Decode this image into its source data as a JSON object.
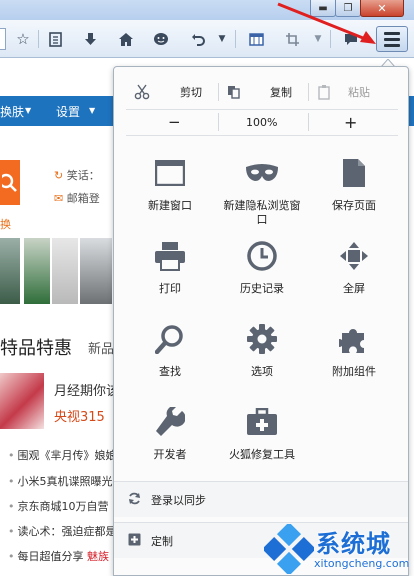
{
  "window": {
    "min_glyph": "▬",
    "max_glyph": "❐",
    "close_glyph": "✕"
  },
  "toolbar": {
    "icons": [
      "star-icon",
      "reading-list-icon",
      "download-icon",
      "home-icon",
      "chat-icon",
      "undo-icon",
      "grid-icon",
      "crop-icon",
      "chat-bubble-icon",
      "hamburger-menu-icon"
    ]
  },
  "page": {
    "nav": [
      "换肤",
      "设置"
    ],
    "side_items": [
      "笑话：",
      "邮箱登",
      "换"
    ],
    "section_title": "特品特惠",
    "section_sub": "新品",
    "promo_line1": "月经期你该",
    "promo_line2": "央视315",
    "news": [
      "围观《芈月传》娘娘",
      "小米5真机谍照曝光",
      "京东商城10万自营",
      "读心术：强迫症都是",
      "每日超值分享"
    ],
    "news_tail": "魅族"
  },
  "menu": {
    "edit": {
      "cut": "剪切",
      "copy": "复制",
      "paste": "粘贴"
    },
    "zoom": {
      "minus": "−",
      "level": "100%",
      "plus": "+"
    },
    "tiles": [
      {
        "label": "新建窗口",
        "icon": "new-window-icon"
      },
      {
        "label": "新建隐私浏览窗口",
        "icon": "private-mask-icon"
      },
      {
        "label": "保存页面",
        "icon": "save-page-icon"
      },
      {
        "label": "打印",
        "icon": "printer-icon"
      },
      {
        "label": "历史记录",
        "icon": "history-clock-icon"
      },
      {
        "label": "全屏",
        "icon": "fullscreen-icon"
      },
      {
        "label": "查找",
        "icon": "search-icon"
      },
      {
        "label": "选项",
        "icon": "gear-icon"
      },
      {
        "label": "附加组件",
        "icon": "puzzle-icon"
      },
      {
        "label": "开发者",
        "icon": "wrench-icon"
      },
      {
        "label": "火狐修复工具",
        "icon": "toolbox-icon"
      }
    ],
    "sync_label": "登录以同步",
    "customize_label": "定制"
  },
  "watermark": {
    "title": "系统城",
    "url": "xitongcheng.com"
  },
  "colors": {
    "nav_blue": "#1e73bf",
    "accent_orange": "#e8701a",
    "arrow_red": "#e02020",
    "watermark_blue": "#1d6fd6",
    "icon_gray": "#5b6470"
  }
}
